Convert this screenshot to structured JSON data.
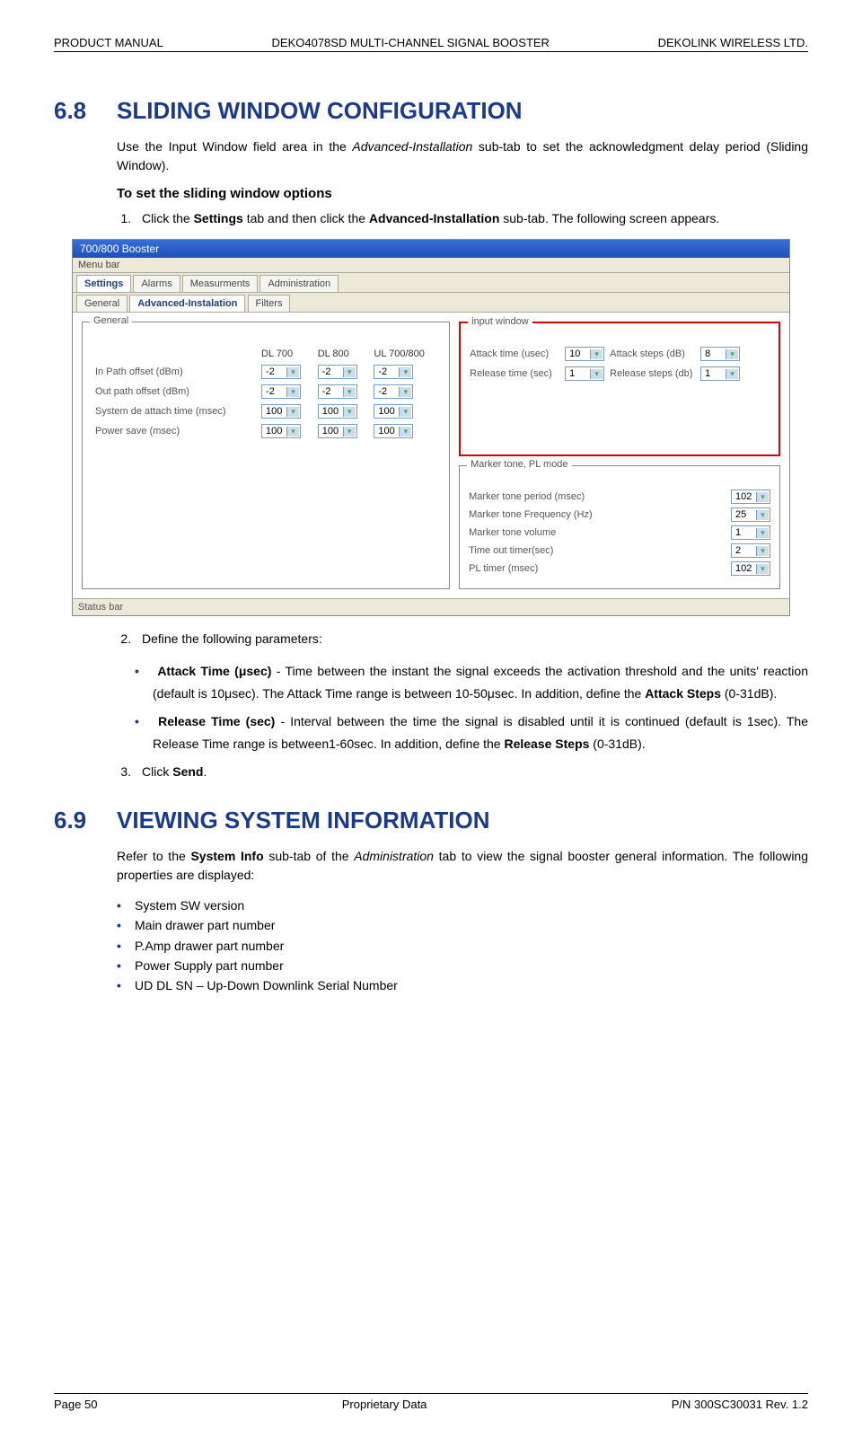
{
  "header": {
    "left": "PRODUCT MANUAL",
    "center": "DEKO4078SD MULTI-CHANNEL SIGNAL BOOSTER",
    "right": "DEKOLINK WIRELESS LTD."
  },
  "section68": {
    "num": "6.8",
    "title": "SLIDING WINDOW CONFIGURATION",
    "intro_a": "Use the Input Window field area in the ",
    "intro_italic": "Advanced-Installation",
    "intro_b": " sub-tab to set the acknowledgment delay period (Sliding Window).",
    "subhead": "To set the sliding window options",
    "step1_a": "Click the ",
    "step1_b": "Settings",
    "step1_c": " tab and then click the ",
    "step1_d": "Advanced-Installation",
    "step1_e": " sub-tab. The following screen appears.",
    "step2": "Define the following parameters:",
    "attack_label": "Attack Time (μsec)",
    "attack_text_a": " - Time between the instant the signal exceeds the activation threshold and the units' reaction (default is 10μsec). The Attack Time range is between 10-50μsec. In addition, define the ",
    "attack_text_b": "Attack Steps",
    "attack_text_c": " (0-31dB).",
    "release_label": "Release Time (sec)",
    "release_text_a": " - Interval between the time the signal is disabled until it is continued (default is 1sec). The Release Time range is between1-60sec. In addition, define the ",
    "release_text_b": "Release Steps",
    "release_text_c": " (0-31dB).",
    "step3_a": "Click ",
    "step3_b": "Send",
    "step3_c": "."
  },
  "screenshot": {
    "titlebar": "700/800 Booster",
    "menubar": "Menu bar",
    "tabs1": [
      "Settings",
      "Alarms",
      "Measurments",
      "Administration"
    ],
    "tabs1_active": 0,
    "tabs2": [
      "General",
      "Advanced-Instalation",
      "Filters"
    ],
    "tabs2_active": 1,
    "general": {
      "legend": "General",
      "cols": [
        "DL 700",
        "DL 800",
        "UL 700/800"
      ],
      "rows": [
        {
          "label": "In Path offset   (dBm)",
          "vals": [
            "-2",
            "-2",
            "-2"
          ]
        },
        {
          "label": "Out path offset (dBm)",
          "vals": [
            "-2",
            "-2",
            "-2"
          ]
        },
        {
          "label": "System de attach time (msec)",
          "vals": [
            "100",
            "100",
            "100"
          ]
        },
        {
          "label": "Power save (msec)",
          "vals": [
            "100",
            "100",
            "100"
          ]
        }
      ]
    },
    "input_window": {
      "legend": "input window",
      "attack_time_label": "Attack time (usec)",
      "attack_time_val": "10",
      "attack_steps_label": "Attack steps (dB)",
      "attack_steps_val": "8",
      "release_time_label": "Release time (sec)",
      "release_time_val": "1",
      "release_steps_label": "Release steps (db)",
      "release_steps_val": "1"
    },
    "marker": {
      "legend": "Marker tone, PL mode",
      "rows": [
        {
          "label": "Marker tone period (msec)",
          "val": "102"
        },
        {
          "label": "Marker tone Frequency (Hz)",
          "val": "25"
        },
        {
          "label": "Marker tone volume",
          "val": "1"
        },
        {
          "label": "Time out timer(sec)",
          "val": "2"
        },
        {
          "label": "PL timer (msec)",
          "val": "102"
        }
      ]
    },
    "statusbar": "Status bar"
  },
  "section69": {
    "num": "6.9",
    "title": "VIEWING SYSTEM INFORMATION",
    "intro_a": "Refer to the ",
    "intro_b": "System Info",
    "intro_c": " sub-tab of the ",
    "intro_d": "Administration",
    "intro_e": " tab to view the signal booster general information. The following properties are displayed:",
    "items": [
      "System SW version",
      "Main drawer part number",
      "P.Amp drawer part number",
      "Power Supply part number",
      "UD DL SN – Up-Down Downlink Serial Number"
    ]
  },
  "footer": {
    "left": "Page 50",
    "center": "Proprietary Data",
    "right": "P/N 300SC30031 Rev. 1.2"
  }
}
